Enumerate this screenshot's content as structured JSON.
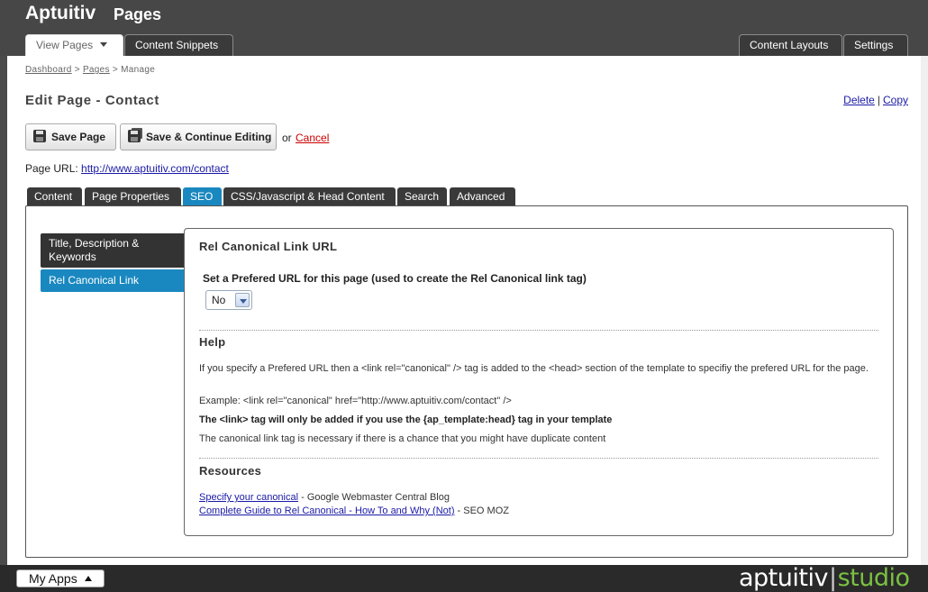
{
  "header": {
    "app_name": "Aptuitiv",
    "section": "Pages",
    "left_tabs": [
      {
        "label": "View Pages",
        "active": true
      },
      {
        "label": "Content Snippets",
        "active": false
      }
    ],
    "right_tabs": [
      {
        "label": "Content Layouts"
      },
      {
        "label": "Settings"
      }
    ]
  },
  "breadcrumb": {
    "items": [
      "Dashboard",
      "Pages",
      "Manage"
    ],
    "separator": ">"
  },
  "page": {
    "title": "Edit Page - Contact",
    "delete_label": "Delete",
    "link_separator": "|",
    "copy_label": "Copy"
  },
  "actions": {
    "save_label": "Save Page",
    "save_continue_label": "Save & Continue Editing",
    "or_text": "or",
    "cancel_label": "Cancel"
  },
  "page_url": {
    "label": "Page URL:",
    "value": "http://www.aptuitiv.com/contact"
  },
  "content_tabs": [
    {
      "label": "Content",
      "active": false
    },
    {
      "label": "Page Properties",
      "active": false
    },
    {
      "label": "SEO",
      "active": true
    },
    {
      "label": "CSS/Javascript & Head Content",
      "active": false
    },
    {
      "label": "Search",
      "active": false
    },
    {
      "label": "Advanced",
      "active": false
    }
  ],
  "seo_nav": [
    {
      "label": "Title, Description & Keywords",
      "active": false
    },
    {
      "label": "Rel Canonical Link",
      "active": true
    }
  ],
  "canonical": {
    "heading": "Rel Canonical Link URL",
    "field_label": "Set a Prefered URL for this page (used to create the Rel Canonical link tag)",
    "select_value": "No",
    "help_heading": "Help",
    "help_p1": "If you specify a Prefered URL then a <link rel=\"canonical\" /> tag is added to the <head> section of the template to specifiy the prefered URL for the page.",
    "help_p2": "Example: <link rel=\"canonical\" href=\"http://www.aptuitiv.com/contact\" />",
    "help_p3": "The <link> tag will only be added if you use the {ap_template:head} tag in your template",
    "help_p4": "The canonical link tag is necessary if there is a chance that you might have duplicate content",
    "resources_heading": "Resources",
    "resources": [
      {
        "link": "Specify your canonical",
        "suffix": " - Google Webmaster Central Blog"
      },
      {
        "link": "Complete Guide to Rel Canonical - How To and Why (Not)",
        "suffix": " - SEO MOZ"
      }
    ]
  },
  "footer": {
    "my_apps_label": "My Apps",
    "brand_word": "aptuitiv",
    "brand_bar": "|",
    "brand_suffix": "studio"
  },
  "colors": {
    "header_bg": "#474747",
    "active_tab_blue": "#1a88c0",
    "link_blue": "#1a1aa6",
    "cancel_red": "#cc0000",
    "brand_green": "#7ac142"
  }
}
